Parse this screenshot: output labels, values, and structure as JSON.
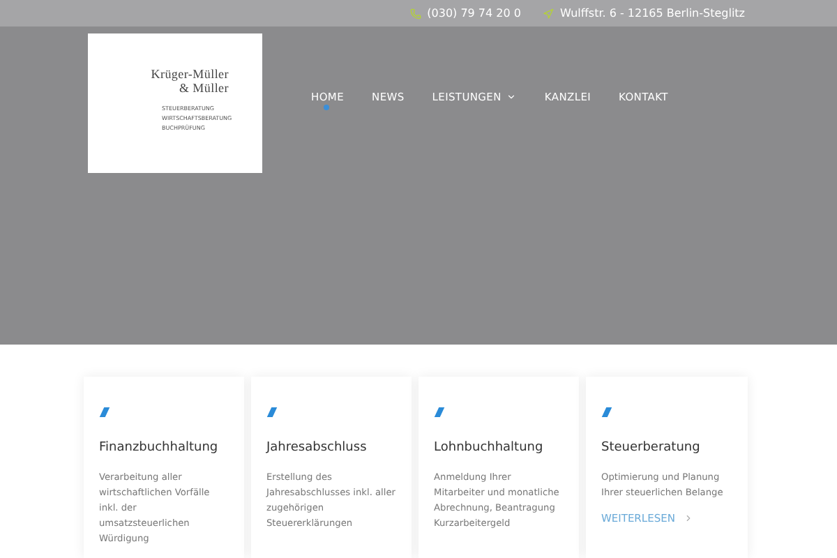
{
  "topbar": {
    "phone": "(030) 79 74 20 0",
    "address": "Wulffstr. 6 - 12165 Berlin-Steglitz"
  },
  "logo": {
    "name_line_1": "Krüger-Müller",
    "name_line_2": "& Müller",
    "services": [
      "STEUERBERATUNG",
      "WIRTSCHAFTSBERATUNG",
      "BUCHPRÜFUNG"
    ]
  },
  "nav": [
    {
      "label": "HOME",
      "selected": true,
      "dropdown": false
    },
    {
      "label": "NEWS",
      "selected": false,
      "dropdown": false
    },
    {
      "label": "LEISTUNGEN",
      "selected": false,
      "dropdown": true
    },
    {
      "label": "KANZLEI",
      "selected": false,
      "dropdown": false
    },
    {
      "label": "KONTAKT",
      "selected": false,
      "dropdown": false
    }
  ],
  "cards": [
    {
      "title": "Finanzbuchhaltung",
      "text": "Verarbeitung aller wirtschaftlichen Vorfälle inkl. der umsatzsteuerlichen Würdigung"
    },
    {
      "title": "Jahresabschluss",
      "text": "Erstellung des Jahresabschlusses inkl. aller zugehörigen Steuererklärungen"
    },
    {
      "title": "Lohnbuchhaltung",
      "text": "Anmeldung Ihrer Mitarbeiter und monatliche Abrechnung, Beantragung Kurzarbeitergeld"
    },
    {
      "title": "Steuerberatung",
      "text": "Optimierung und Planung Ihrer steuerlichen Belange",
      "link": "WEITERLESEN"
    }
  ]
}
